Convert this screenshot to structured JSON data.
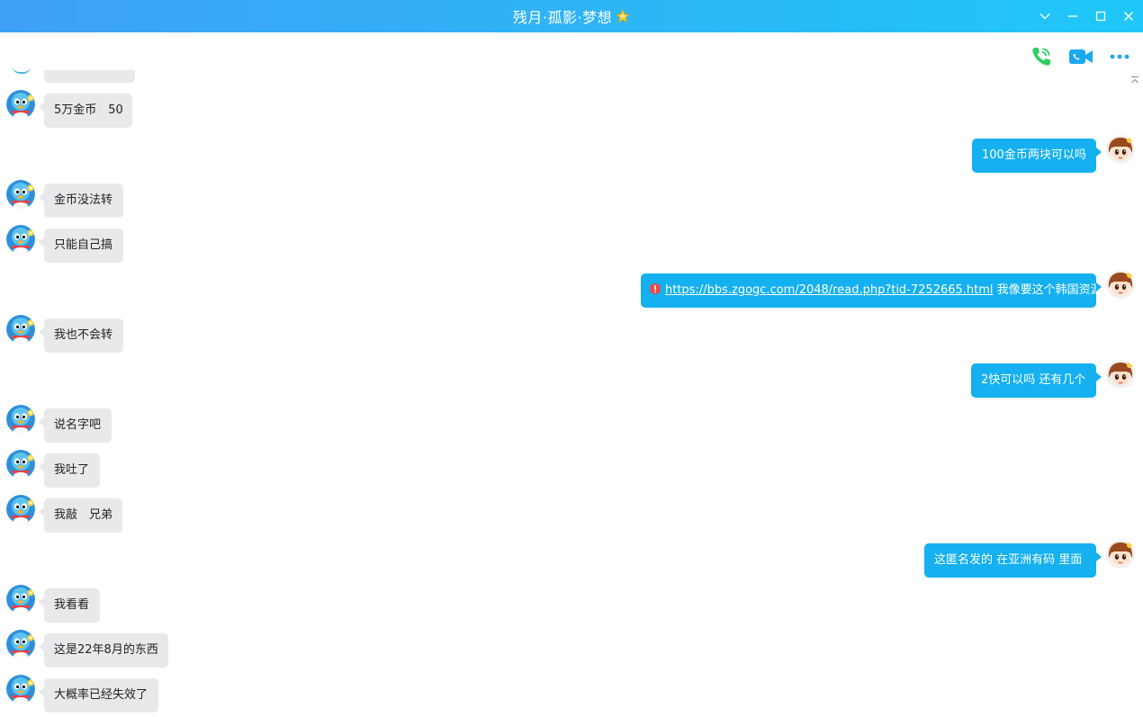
{
  "window": {
    "title": "残月·孤影·梦想",
    "title_star_icon": "star-badge-icon",
    "controls": [
      "chevron-down-icon",
      "minimize-icon",
      "maximize-icon",
      "close-icon"
    ]
  },
  "toolbar": {
    "icons": [
      "phone-call-icon",
      "video-call-icon",
      "more-icon"
    ]
  },
  "colors": {
    "titlebar_start": "#3ea0f5",
    "titlebar_end": "#1fc7f8",
    "incoming_bubble": "#e9e9eb",
    "outgoing_bubble": "#14b0f0",
    "phone_icon": "#2ecf63",
    "video_icon": "#1aa8f0"
  },
  "messages": [
    {
      "side": "in",
      "text": "5万金币　50"
    },
    {
      "side": "out",
      "text": "100金币两块可以吗"
    },
    {
      "side": "in",
      "text": "金币没法转"
    },
    {
      "side": "in",
      "text": "只能自己搞"
    },
    {
      "side": "out",
      "link": "https://bbs.zgogc.com/2048/read.php?tid-7252665.html",
      "text": " 我像要这个韩国资源"
    },
    {
      "side": "in",
      "text": "我也不会转"
    },
    {
      "side": "out",
      "text": "2快可以吗 还有几个"
    },
    {
      "side": "in",
      "text": "说名字吧"
    },
    {
      "side": "in",
      "text": "我吐了"
    },
    {
      "side": "in",
      "text": "我敲　兄弟"
    },
    {
      "side": "out",
      "text": "这匿名发的  在亚洲有码 里面"
    },
    {
      "side": "in",
      "text": "我看看"
    },
    {
      "side": "in",
      "text": "这是22年8月的东西"
    },
    {
      "side": "in",
      "text": "大概率已经失效了"
    }
  ]
}
